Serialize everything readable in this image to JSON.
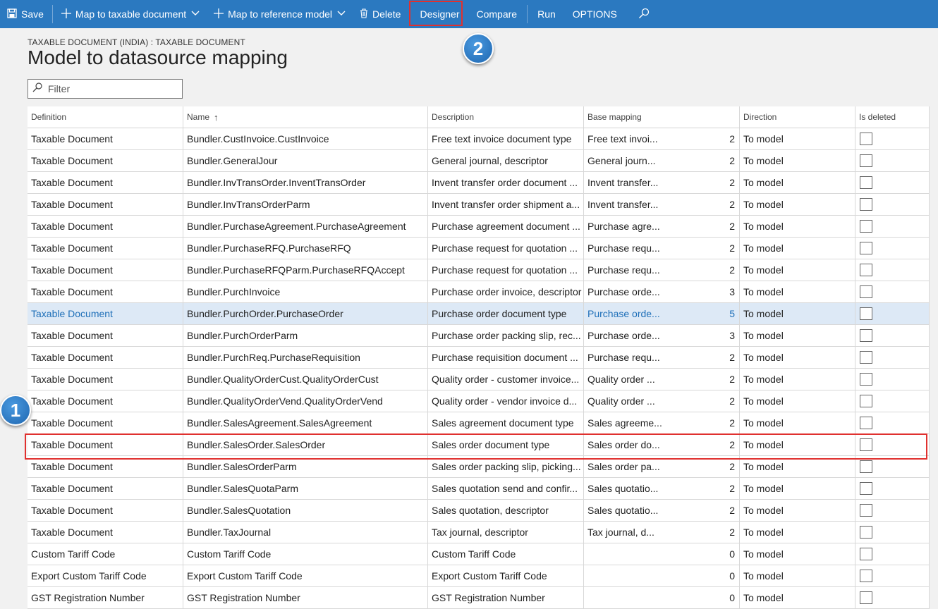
{
  "toolbar": {
    "save": "Save",
    "map_taxable": "Map to taxable document",
    "map_reference": "Map to reference model",
    "delete": "Delete",
    "designer": "Designer",
    "compare": "Compare",
    "run": "Run",
    "options": "OPTIONS"
  },
  "header": {
    "breadcrumb": "TAXABLE DOCUMENT (INDIA) : TAXABLE DOCUMENT",
    "title": "Model to datasource mapping"
  },
  "filter": {
    "placeholder": "Filter"
  },
  "grid": {
    "columns": {
      "definition": "Definition",
      "name": "Name",
      "description": "Description",
      "base_mapping": "Base mapping",
      "direction": "Direction",
      "is_deleted": "Is deleted"
    },
    "rows": [
      {
        "definition": "Taxable Document",
        "name": "Bundler.CustInvoice.CustInvoice",
        "description": "Free text invoice document type",
        "base": "Free text invoi...",
        "version": "2",
        "direction": "To model"
      },
      {
        "definition": "Taxable Document",
        "name": "Bundler.GeneralJour",
        "description": "General journal, descriptor",
        "base": "General journ...",
        "version": "2",
        "direction": "To model"
      },
      {
        "definition": "Taxable Document",
        "name": "Bundler.InvTransOrder.InventTransOrder",
        "description": "Invent transfer order document ...",
        "base": "Invent transfer...",
        "version": "2",
        "direction": "To model"
      },
      {
        "definition": "Taxable Document",
        "name": "Bundler.InvTransOrderParm",
        "description": "Invent transfer order shipment a...",
        "base": "Invent transfer...",
        "version": "2",
        "direction": "To model"
      },
      {
        "definition": "Taxable Document",
        "name": "Bundler.PurchaseAgreement.PurchaseAgreement",
        "description": "Purchase agreement document ...",
        "base": "Purchase agre...",
        "version": "2",
        "direction": "To model"
      },
      {
        "definition": "Taxable Document",
        "name": "Bundler.PurchaseRFQ.PurchaseRFQ",
        "description": "Purchase request for quotation ...",
        "base": "Purchase requ...",
        "version": "2",
        "direction": "To model"
      },
      {
        "definition": "Taxable Document",
        "name": "Bundler.PurchaseRFQParm.PurchaseRFQAccept",
        "description": "Purchase request for quotation ...",
        "base": "Purchase requ...",
        "version": "2",
        "direction": "To model"
      },
      {
        "definition": "Taxable Document",
        "name": "Bundler.PurchInvoice",
        "description": "Purchase order invoice, descriptor",
        "base": "Purchase orde...",
        "version": "3",
        "direction": "To model"
      },
      {
        "definition": "Taxable Document",
        "name": "Bundler.PurchOrder.PurchaseOrder",
        "description": "Purchase order document type",
        "base": "Purchase orde...",
        "version": "5",
        "direction": "To model",
        "selected": true
      },
      {
        "definition": "Taxable Document",
        "name": "Bundler.PurchOrderParm",
        "description": "Purchase order packing slip, rec...",
        "base": "Purchase orde...",
        "version": "3",
        "direction": "To model"
      },
      {
        "definition": "Taxable Document",
        "name": "Bundler.PurchReq.PurchaseRequisition",
        "description": "Purchase requisition document ...",
        "base": "Purchase requ...",
        "version": "2",
        "direction": "To model"
      },
      {
        "definition": "Taxable Document",
        "name": "Bundler.QualityOrderCust.QualityOrderCust",
        "description": "Quality order - customer invoice...",
        "base": "Quality order ...",
        "version": "2",
        "direction": "To model"
      },
      {
        "definition": "Taxable Document",
        "name": "Bundler.QualityOrderVend.QualityOrderVend",
        "description": "Quality order - vendor invoice d...",
        "base": "Quality order ...",
        "version": "2",
        "direction": "To model"
      },
      {
        "definition": "Taxable Document",
        "name": "Bundler.SalesAgreement.SalesAgreement",
        "description": "Sales agreement document type",
        "base": "Sales agreeme...",
        "version": "2",
        "direction": "To model"
      },
      {
        "definition": "Taxable Document",
        "name": "Bundler.SalesOrder.SalesOrder",
        "description": "Sales order document type",
        "base": "Sales order do...",
        "version": "2",
        "direction": "To model"
      },
      {
        "definition": "Taxable Document",
        "name": "Bundler.SalesOrderParm",
        "description": "Sales order packing slip, picking...",
        "base": "Sales order pa...",
        "version": "2",
        "direction": "To model"
      },
      {
        "definition": "Taxable Document",
        "name": "Bundler.SalesQuotaParm",
        "description": "Sales quotation send and confir...",
        "base": "Sales quotatio...",
        "version": "2",
        "direction": "To model"
      },
      {
        "definition": "Taxable Document",
        "name": "Bundler.SalesQuotation",
        "description": "Sales quotation, descriptor",
        "base": "Sales quotatio...",
        "version": "2",
        "direction": "To model"
      },
      {
        "definition": "Taxable Document",
        "name": "Bundler.TaxJournal",
        "description": "Tax journal, descriptor",
        "base": "Tax journal, d...",
        "version": "2",
        "direction": "To model"
      },
      {
        "definition": "Custom Tariff Code",
        "name": "Custom Tariff Code",
        "description": "Custom Tariff Code",
        "base": "",
        "version": "0",
        "direction": "To model"
      },
      {
        "definition": "Export Custom Tariff Code",
        "name": "Export Custom Tariff Code",
        "description": "Export Custom Tariff Code",
        "base": "",
        "version": "0",
        "direction": "To model"
      },
      {
        "definition": "GST Registration Number",
        "name": "GST Registration Number",
        "description": "GST Registration Number",
        "base": "",
        "version": "0",
        "direction": "To model"
      }
    ]
  },
  "annotations": {
    "badge1": "1",
    "badge2": "2"
  },
  "colors": {
    "toolbar": "#2b79c0",
    "highlight": "#e0312f",
    "selected_row": "#dde9f6",
    "badge": "#1e66b0"
  }
}
